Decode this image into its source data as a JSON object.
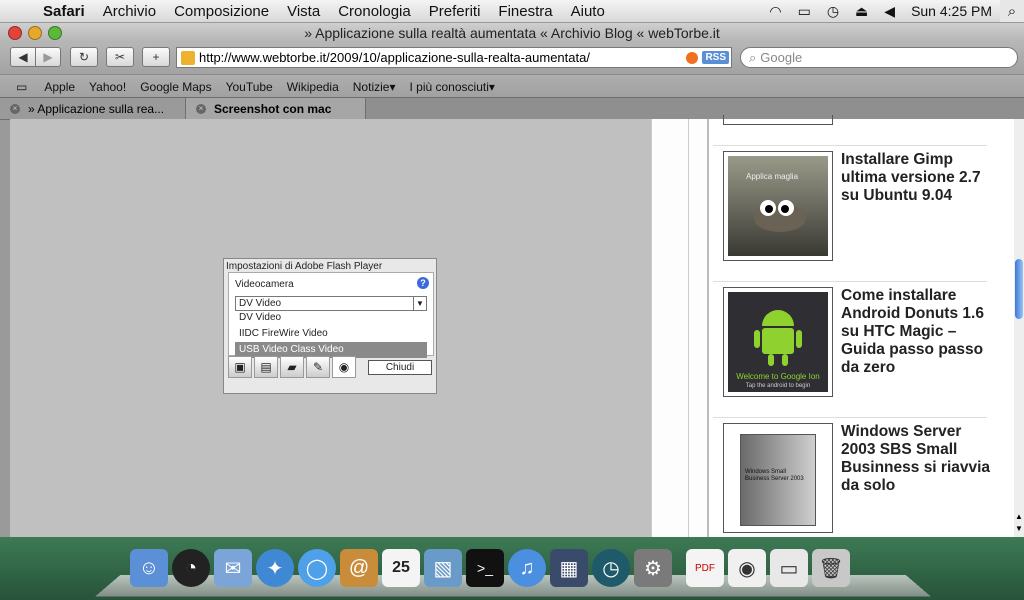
{
  "menubar": {
    "items": [
      "Safari",
      "Archivio",
      "Composizione",
      "Vista",
      "Cronologia",
      "Preferiti",
      "Finestra",
      "Aiuto"
    ],
    "clock": "Sun 4:25 PM"
  },
  "window": {
    "title": "» Applicazione sulla realtà aumentata « Archivio Blog « webTorbe.it"
  },
  "toolbar": {
    "url": "http://www.webtorbe.it/2009/10/applicazione-sulla-realta-aumentata/",
    "rss_label": "RSS",
    "search_placeholder": "Google"
  },
  "bookmarks": [
    "Apple",
    "Yahoo!",
    "Google Maps",
    "YouTube",
    "Wikipedia",
    "Notizie",
    "I più conosciuti"
  ],
  "tabs": [
    {
      "label": "» Applicazione sulla rea..."
    },
    {
      "label": "Screenshot con mac"
    }
  ],
  "flash_dialog": {
    "header": "Impostazioni di Adobe Flash Player",
    "section": "Videocamera",
    "selected": "DV Video",
    "options": [
      "DV Video",
      "IIDC FireWire Video",
      "USB Video Class Video"
    ],
    "highlighted_index": 2,
    "close_label": "Chiudi"
  },
  "sidebar_posts": [
    {
      "title": "Installare Gimp ultima versione 2.7 su Ubuntu 9.04",
      "thumb_text": "Applica maglia"
    },
    {
      "title": "Come installare Android Donuts 1.6 su HTC Magic – Guida passo passo da zero",
      "thumb_text": "Welcome to Google Ion",
      "thumb_sub": "Tap the android to begin"
    },
    {
      "title": "Windows Server 2003 SBS Small Businness si riavvia da solo",
      "thumb_text": "Windows Small Business Server 2003"
    }
  ],
  "dock_icons": [
    "finder-icon",
    "dashboard-icon",
    "mail-icon",
    "safari-icon",
    "ichat-icon",
    "addressbook-icon",
    "ical-icon",
    "iphoto-icon",
    "terminal-icon",
    "itunes-icon",
    "spaces-icon",
    "timemachine-icon",
    "systemprefs-icon",
    "pdf-icon",
    "preview-icon",
    "screenshot-icon",
    "trash-icon"
  ],
  "ical_date": "25",
  "colors": {
    "accent": "#3c6ad8",
    "dock": "#2e6344"
  }
}
